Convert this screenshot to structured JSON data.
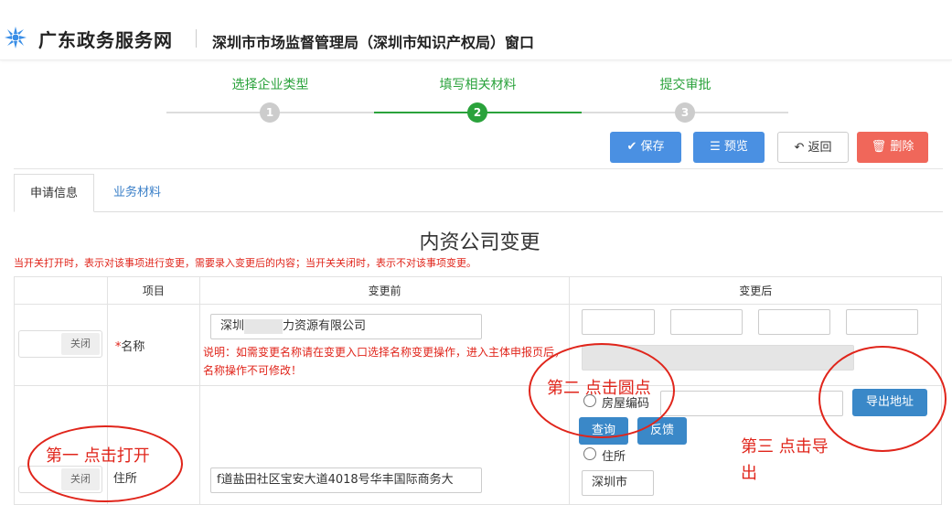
{
  "header": {
    "site_name": "广东政务服务网",
    "department": "深圳市市场监督管理局（深圳市知识产权局）窗口"
  },
  "steps": [
    {
      "label": "选择企业类型",
      "number": "1",
      "state": "done"
    },
    {
      "label": "填写相关材料",
      "number": "2",
      "state": "active"
    },
    {
      "label": "提交审批",
      "number": "3",
      "state": "pending"
    }
  ],
  "toolbar": {
    "save": "保存",
    "preview": "预览",
    "back": "返回",
    "delete": "删除"
  },
  "tabs": [
    "申请信息",
    "业务材料"
  ],
  "form": {
    "title": "内资公司变更",
    "note": "当开关打开时，表示对该事项进行变更，需要录入变更后的内容；当开关关闭时，表示不对该事项变更。",
    "headers": [
      "项目",
      "变更前",
      "变更后"
    ],
    "rows": {
      "name": {
        "toggle": "关闭",
        "required_mark": "*",
        "label": "名称",
        "before_prefix": "深圳",
        "before_suffix": "力资源有限公司",
        "explain": "说明：如需变更名称请在变更入口选择名称变更操作，进入主体申报页后，名称操作不可修改！"
      },
      "address": {
        "toggle": "关闭",
        "label": "住所",
        "before_value": "f道盐田社区宝安大道4018号华丰国际商务大",
        "radio_house": "房屋编码",
        "query": "查询",
        "feedback": "反馈",
        "export": "导出地址",
        "radio_residence": "住所",
        "city": "深圳市"
      }
    }
  },
  "annotations": {
    "first": "第一 点击打开",
    "second": "第二 点击圆点",
    "third_line1": "第三 点击导",
    "third_line2": "出"
  },
  "colors": {
    "accent_green": "#2aa23b",
    "primary_blue": "#4a90e2",
    "danger_red": "#f0675a",
    "annotation_red": "#e0251b"
  }
}
